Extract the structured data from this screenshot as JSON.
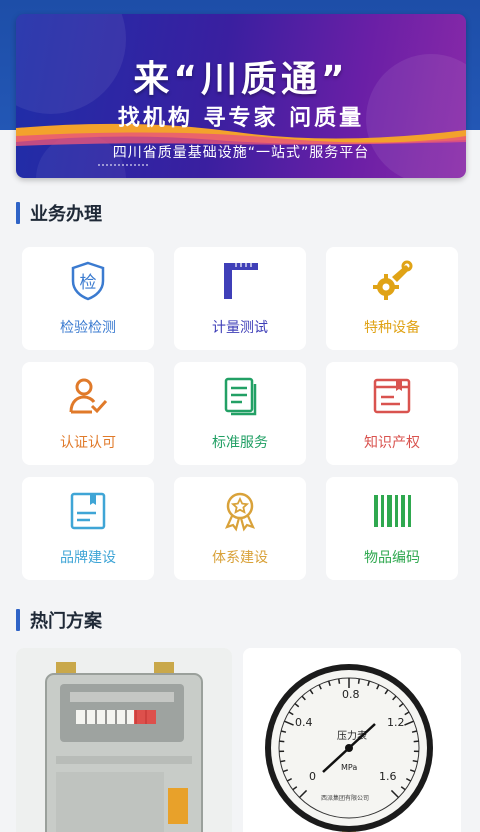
{
  "banner": {
    "title": "来“川质通”",
    "subtitle": "找机构  寻专家  问质量",
    "platform": "四川省质量基础设施“一站式”服务平台"
  },
  "sections": {
    "business": "业务办理",
    "hot": "热门方案"
  },
  "services": [
    {
      "label": "检验检测",
      "icon": "shield-check-icon",
      "color": "#3b7bd0"
    },
    {
      "label": "计量测试",
      "icon": "ruler-square-icon",
      "color": "#3f3fb8"
    },
    {
      "label": "特种设备",
      "icon": "gear-wrench-icon",
      "color": "#e0a316"
    },
    {
      "label": "认证认可",
      "icon": "user-check-icon",
      "color": "#e07a2a"
    },
    {
      "label": "标准服务",
      "icon": "document-icon",
      "color": "#22a065"
    },
    {
      "label": "知识产权",
      "icon": "book-icon",
      "color": "#d9534f"
    },
    {
      "label": "品牌建设",
      "icon": "notebook-icon",
      "color": "#3fa5d6"
    },
    {
      "label": "体系建设",
      "icon": "award-icon",
      "color": "#d9a23a"
    },
    {
      "label": "物品编码",
      "icon": "barcode-icon",
      "color": "#2fa84f"
    }
  ],
  "hot_items": [
    {
      "name": "gas-meter-image"
    },
    {
      "name": "pressure-gauge-image",
      "gauge": {
        "label": "压力表",
        "unit": "MPa",
        "ticks": [
          "0",
          "0.4",
          "0.8",
          "1.2",
          "1.6"
        ],
        "maker": "西派集团有限公司"
      }
    }
  ]
}
